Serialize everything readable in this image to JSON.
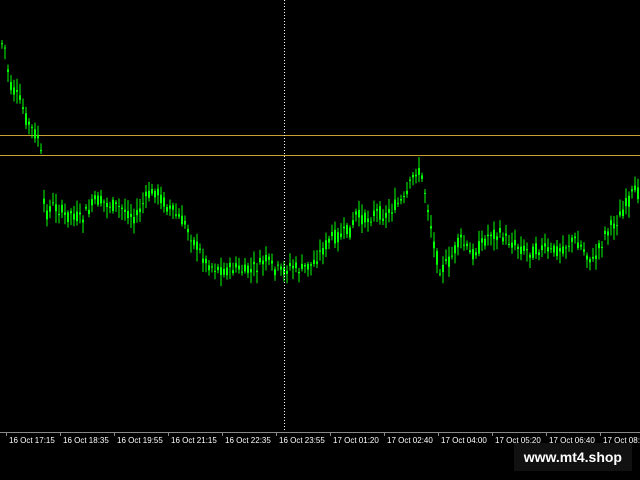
{
  "colors": {
    "background": "#000000",
    "candle_up": "#00ff00",
    "candle_down": "#00ff00",
    "horizontal_lines": "#c8a032",
    "crosshair": "#ffffff",
    "axis_text": "#ffffff"
  },
  "chart": {
    "time_axis": {
      "labels": [
        "16 Oct 17:15",
        "16 Oct 18:35",
        "16 Oct 19:55",
        "16 Oct 21:15",
        "16 Oct 22:35",
        "16 Oct 23:55",
        "17 Oct 01:20",
        "17 Oct 02:40",
        "17 Oct 04:00",
        "17 Oct 05:20",
        "17 Oct 06:40",
        "17 Oct 08:"
      ]
    },
    "horizontal_levels": 2,
    "crosshair_vertical": true
  },
  "chart_data": {
    "type": "candlestick",
    "title": "",
    "xlabel": "",
    "ylabel": "",
    "x_ticks": [
      "16 Oct 17:15",
      "16 Oct 18:35",
      "16 Oct 19:55",
      "16 Oct 21:15",
      "16 Oct 22:35",
      "16 Oct 23:55",
      "17 Oct 01:20",
      "17 Oct 02:40",
      "17 Oct 04:00",
      "17 Oct 05:20",
      "17 Oct 06:40",
      "17 Oct 08:"
    ],
    "price_profile": [
      [
        0,
        45
      ],
      [
        3,
        40
      ],
      [
        6,
        65
      ],
      [
        10,
        88
      ],
      [
        15,
        95
      ],
      [
        20,
        102
      ],
      [
        25,
        118
      ],
      [
        30,
        128
      ],
      [
        38,
        138
      ],
      [
        40,
        155
      ],
      [
        42,
        200
      ],
      [
        45,
        215
      ],
      [
        50,
        205
      ],
      [
        60,
        210
      ],
      [
        65,
        218
      ],
      [
        70,
        212
      ],
      [
        80,
        220
      ],
      [
        95,
        200
      ],
      [
        110,
        205
      ],
      [
        125,
        210
      ],
      [
        135,
        218
      ],
      [
        145,
        198
      ],
      [
        155,
        190
      ],
      [
        165,
        205
      ],
      [
        175,
        215
      ],
      [
        185,
        225
      ],
      [
        195,
        245
      ],
      [
        205,
        262
      ],
      [
        215,
        268
      ],
      [
        225,
        270
      ],
      [
        235,
        268
      ],
      [
        245,
        272
      ],
      [
        255,
        268
      ],
      [
        265,
        260
      ],
      [
        272,
        268
      ],
      [
        280,
        272
      ],
      [
        290,
        266
      ],
      [
        300,
        270
      ],
      [
        310,
        265
      ],
      [
        320,
        252
      ],
      [
        330,
        238
      ],
      [
        340,
        235
      ],
      [
        350,
        230
      ],
      [
        355,
        215
      ],
      [
        365,
        220
      ],
      [
        375,
        212
      ],
      [
        385,
        215
      ],
      [
        395,
        205
      ],
      [
        405,
        200
      ],
      [
        410,
        182
      ],
      [
        415,
        170
      ],
      [
        420,
        175
      ],
      [
        425,
        195
      ],
      [
        430,
        225
      ],
      [
        435,
        255
      ],
      [
        440,
        270
      ],
      [
        448,
        262
      ],
      [
        455,
        248
      ],
      [
        460,
        240
      ],
      [
        470,
        255
      ],
      [
        480,
        245
      ],
      [
        490,
        232
      ],
      [
        500,
        235
      ],
      [
        510,
        242
      ],
      [
        520,
        248
      ],
      [
        530,
        252
      ],
      [
        540,
        248
      ],
      [
        550,
        252
      ],
      [
        560,
        248
      ],
      [
        570,
        242
      ],
      [
        575,
        240
      ],
      [
        585,
        252
      ],
      [
        592,
        262
      ],
      [
        600,
        245
      ],
      [
        605,
        232
      ],
      [
        615,
        222
      ],
      [
        625,
        205
      ],
      [
        633,
        192
      ],
      [
        640,
        195
      ]
    ],
    "horizontal_levels": 2
  }
}
